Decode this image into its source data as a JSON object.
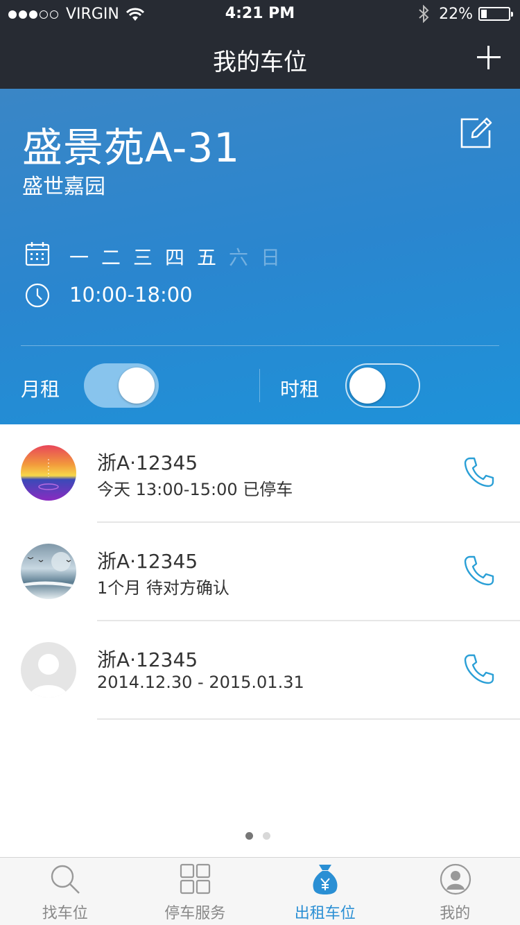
{
  "status_bar": {
    "signal_dots_filled": 3,
    "signal_dots_total": 5,
    "carrier": "VIRGIN",
    "time": "4:21 PM",
    "battery_text": "22%",
    "battery_level": 0.22
  },
  "nav": {
    "title": "我的车位",
    "add_icon": "plus-icon"
  },
  "spot": {
    "name": "盛景苑A-31",
    "community": "盛世嘉园",
    "edit_icon": "edit-icon",
    "days": [
      {
        "label": "一",
        "active": true
      },
      {
        "label": "二",
        "active": true
      },
      {
        "label": "三",
        "active": true
      },
      {
        "label": "四",
        "active": true
      },
      {
        "label": "五",
        "active": true
      },
      {
        "label": "六",
        "active": false
      },
      {
        "label": "日",
        "active": false
      }
    ],
    "hours": "10:00-18:00",
    "monthly_label": "月租",
    "monthly_on": true,
    "hourly_label": "时租",
    "hourly_on": false
  },
  "renters": [
    {
      "plate": "浙A·12345",
      "detail": "今天 13:00-15:00  已停车",
      "avatar": "sunset-avatar"
    },
    {
      "plate": "浙A·12345",
      "detail": "1个月  待对方确认",
      "avatar": "seascape-avatar"
    },
    {
      "plate": "浙A·12345",
      "detail": "2014.12.30 - 2015.01.31",
      "avatar": "default-avatar"
    }
  ],
  "pager": {
    "current": 1,
    "total": 2
  },
  "tabs": [
    {
      "label": "找车位",
      "icon": "search-icon",
      "active": false
    },
    {
      "label": "停车服务",
      "icon": "grid-icon",
      "active": false
    },
    {
      "label": "出租车位",
      "icon": "money-bag-icon",
      "active": true
    },
    {
      "label": "我的",
      "icon": "user-icon",
      "active": false
    }
  ],
  "colors": {
    "nav_bg": "#272b33",
    "hero_blue": "#2a86cf",
    "accent": "#2a8fd4",
    "phone_icon": "#2a9fd6"
  }
}
